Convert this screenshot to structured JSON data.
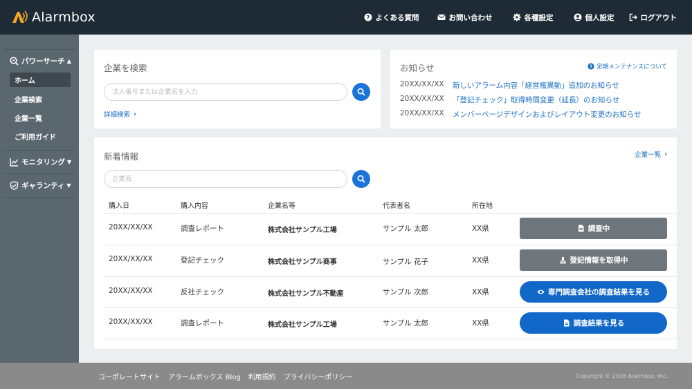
{
  "app": {
    "logo_text": "Alarmbox",
    "brand_color": "#1e2b36",
    "accent_color": "#1a73d9",
    "logo_color": "#f5a623"
  },
  "header": {
    "nav": [
      {
        "label": "よくある質問",
        "icon": "question-circle-icon"
      },
      {
        "label": "お問い合わせ",
        "icon": "envelope-icon"
      },
      {
        "label": "各種設定",
        "icon": "gear-icon"
      },
      {
        "label": "個人設定",
        "icon": "user-circle-icon"
      },
      {
        "label": "ログアウト",
        "icon": "logout-icon"
      }
    ]
  },
  "sidebar": {
    "sections": [
      {
        "label": "パワーサーチ",
        "icon": "search-chart-icon",
        "expanded": true,
        "items": [
          {
            "label": "ホーム",
            "active": true
          },
          {
            "label": "企業検索",
            "active": false
          },
          {
            "label": "企業一覧",
            "active": false
          },
          {
            "label": "ご利用ガイド",
            "active": false
          }
        ]
      },
      {
        "label": "モニタリング",
        "icon": "line-chart-icon",
        "expanded": false
      },
      {
        "label": "ギャランティ",
        "icon": "shield-check-icon",
        "expanded": false
      }
    ]
  },
  "company_search": {
    "title": "企業を検索",
    "placeholder": "法人番号または企業名を入力",
    "advanced_link": "詳細検索"
  },
  "notices": {
    "title": "お知らせ",
    "maintenance_link": "定期メンテナンスについて",
    "items": [
      {
        "date": "20XX/XX/XX",
        "text": "新しいアラーム内容「経営権異動」追加のお知らせ"
      },
      {
        "date": "20XX/XX/XX",
        "text": "「登記チェック」取得時間変更（延長）のお知らせ"
      },
      {
        "date": "20XX/XX/XX",
        "text": "メンバーページデザインおよびレイアウト変更のお知らせ"
      }
    ]
  },
  "news": {
    "title": "新着情報",
    "list_link": "企業一覧",
    "filter_placeholder": "企業名",
    "columns": [
      "購入日",
      "購入内容",
      "企業名等",
      "代表者名",
      "所在地"
    ],
    "rows": [
      {
        "date": "20XX/XX/XX",
        "content": "調査レポート",
        "company": "株式会社サンプル工場",
        "rep": "サンプル 太郎",
        "location": "XX県",
        "action": "調査中",
        "style": "gray",
        "icon": "document-icon"
      },
      {
        "date": "20XX/XX/XX",
        "content": "登記チェック",
        "company": "株式会社サンプル商事",
        "rep": "サンプル 花子",
        "location": "XX県",
        "action": "登記情報を取得中",
        "style": "gray",
        "icon": "stamp-icon"
      },
      {
        "date": "20XX/XX/XX",
        "content": "反社チェック",
        "company": "株式会社サンプル不動産",
        "rep": "サンプル 次郎",
        "location": "XX県",
        "action": "専門調査会社の調査結果を見る",
        "style": "blue",
        "icon": "eye-icon"
      },
      {
        "date": "20XX/XX/XX",
        "content": "調査レポート",
        "company": "株式会社サンプル工場",
        "rep": "サンプル 太郎",
        "location": "XX県",
        "action": "調査結果を見る",
        "style": "blue",
        "icon": "document-icon"
      }
    ]
  },
  "footer": {
    "links": [
      "コーポレートサイト",
      "アラームボックス Blog",
      "利用規約",
      "プライバシーポリシー"
    ],
    "copyright": "Copyright © 2016 Alarmbox, Inc."
  }
}
